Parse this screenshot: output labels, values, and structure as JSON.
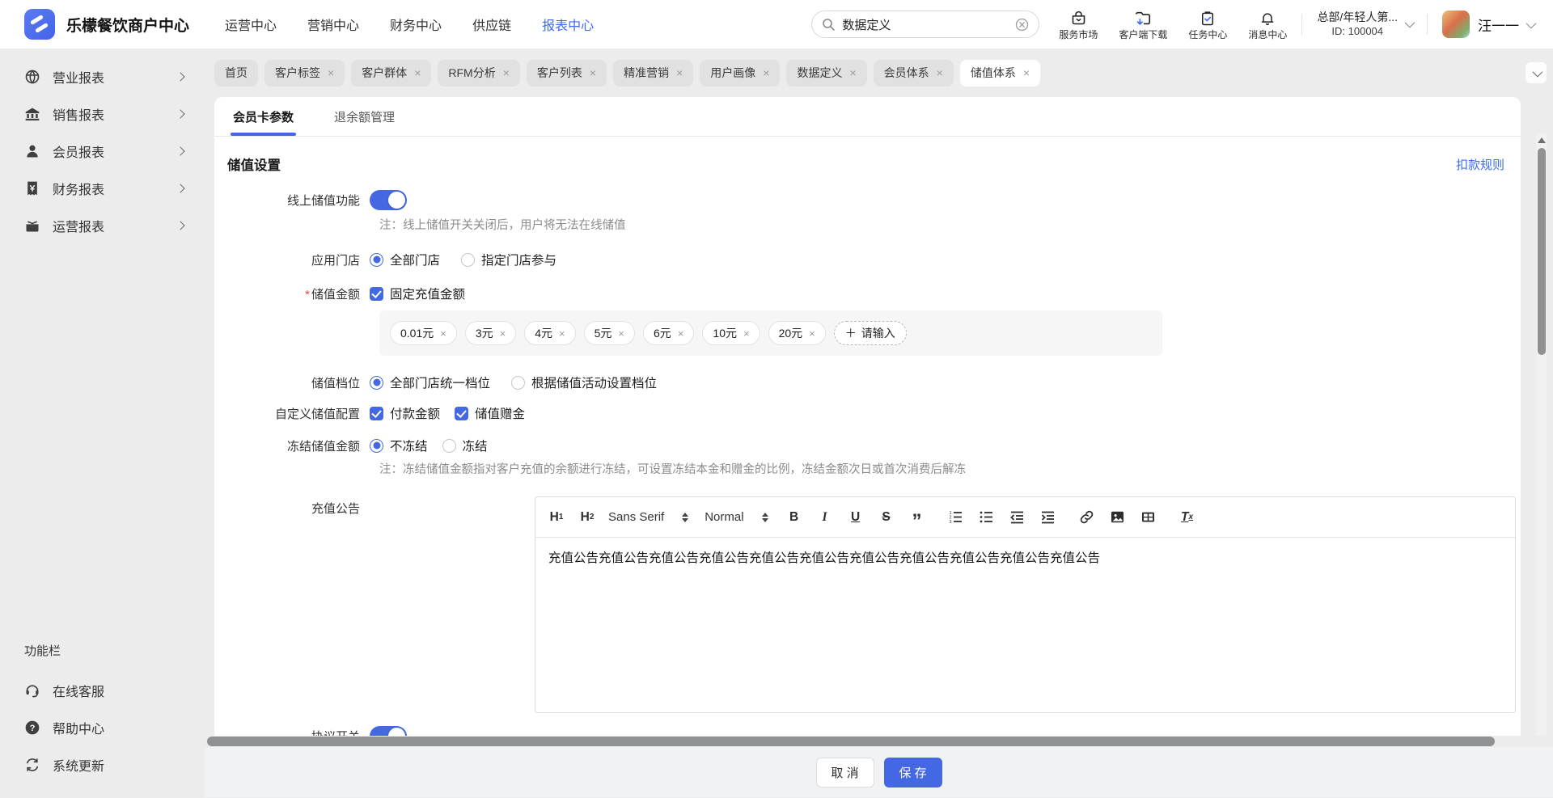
{
  "icons": {
    "close": "×",
    "plus": "＋"
  },
  "topbar": {
    "logo_title": "乐檬餐饮商户中心",
    "nav": [
      {
        "label": "运营中心",
        "active": false
      },
      {
        "label": "营销中心",
        "active": false
      },
      {
        "label": "财务中心",
        "active": false
      },
      {
        "label": "供应链",
        "active": false
      },
      {
        "label": "报表中心",
        "active": true
      }
    ],
    "search": {
      "value": "数据定义"
    },
    "quick": [
      {
        "label": "服务市场",
        "icon": "storefront-bag-icon"
      },
      {
        "label": "客户端下载",
        "icon": "folder-download-icon"
      },
      {
        "label": "任务中心",
        "icon": "clipboard-check-icon"
      },
      {
        "label": "消息中心",
        "icon": "bell-icon"
      }
    ],
    "org": {
      "name": "总部/年轻人第...",
      "id": "ID: 100004"
    },
    "user": {
      "name": "汪一一"
    }
  },
  "tabstrip": {
    "tabs": [
      {
        "label": "首页",
        "closable": false,
        "active": false
      },
      {
        "label": "客户标签",
        "closable": true,
        "active": false
      },
      {
        "label": "客户群体",
        "closable": true,
        "active": false
      },
      {
        "label": "RFM分析",
        "closable": true,
        "active": false
      },
      {
        "label": "客户列表",
        "closable": true,
        "active": false
      },
      {
        "label": "精准营销",
        "closable": true,
        "active": false
      },
      {
        "label": "用户画像",
        "closable": true,
        "active": false
      },
      {
        "label": "数据定义",
        "closable": true,
        "active": false
      },
      {
        "label": "会员体系",
        "closable": true,
        "active": false
      },
      {
        "label": "储值体系",
        "closable": true,
        "active": true
      }
    ]
  },
  "sidebar": {
    "items": [
      {
        "label": "营业报表",
        "icon": "globe-icon"
      },
      {
        "label": "销售报表",
        "icon": "bank-icon"
      },
      {
        "label": "会员报表",
        "icon": "member-icon"
      },
      {
        "label": "财务报表",
        "icon": "receipt-yuan-icon"
      },
      {
        "label": "运营报表",
        "icon": "box-icon"
      }
    ],
    "section_label": "功能栏",
    "tools": [
      {
        "label": "在线客服",
        "icon": "headset-icon"
      },
      {
        "label": "帮助中心",
        "icon": "help-circle-icon"
      },
      {
        "label": "系统更新",
        "icon": "refresh-icon"
      }
    ]
  },
  "content": {
    "tabs": [
      {
        "label": "会员卡参数",
        "active": true
      },
      {
        "label": "退余额管理",
        "active": false
      }
    ],
    "section_title": "储值设置",
    "header_link": "扣款规则",
    "form": {
      "online": {
        "label": "线上储值功能",
        "on": true,
        "note": "注：线上储值开关关闭后，用户将无法在线储值"
      },
      "stores": {
        "label": "应用门店",
        "options": [
          {
            "label": "全部门店",
            "selected": true
          },
          {
            "label": "指定门店参与",
            "selected": false
          }
        ]
      },
      "amount": {
        "label": "储值金额",
        "required_mark": "*",
        "checkbox": "固定充值金额",
        "checked": true,
        "tags": [
          "0.01元",
          "3元",
          "4元",
          "5元",
          "6元",
          "10元",
          "20元"
        ],
        "add_label": "请输入"
      },
      "tier": {
        "label": "储值档位",
        "options": [
          {
            "label": "全部门店统一档位",
            "selected": true
          },
          {
            "label": "根据储值活动设置档位",
            "selected": false
          }
        ]
      },
      "custom": {
        "label": "自定义储值配置",
        "checkboxes": [
          {
            "label": "付款金额",
            "checked": true
          },
          {
            "label": "储值赠金",
            "checked": true
          }
        ]
      },
      "freeze": {
        "label": "冻结储值金额",
        "options": [
          {
            "label": "不冻结",
            "selected": true
          },
          {
            "label": "冻结",
            "selected": false
          }
        ],
        "note": "注：冻结储值金额指对客户充值的余额进行冻结，可设置冻结本金和赠金的比例，冻结金额次日或首次消费后解冻"
      },
      "notice": {
        "label": "充值公告",
        "toolbar": {
          "h1_t": "H",
          "h1_s": "1",
          "h2_t": "H",
          "h2_s": "2",
          "font": "Sans Serif",
          "size": "Normal",
          "bold": "B",
          "italic": "I",
          "underline": "U",
          "strike": "S",
          "quote": "”",
          "clean_t": "T",
          "clean_s": "x"
        },
        "content": "充值公告充值公告充值公告充值公告充值公告充值公告充值公告充值公告充值公告充值公告充值公告"
      },
      "agreement": {
        "label": "协议开关",
        "on": true
      }
    },
    "footer": {
      "cancel": "取 消",
      "save": "保 存"
    }
  }
}
